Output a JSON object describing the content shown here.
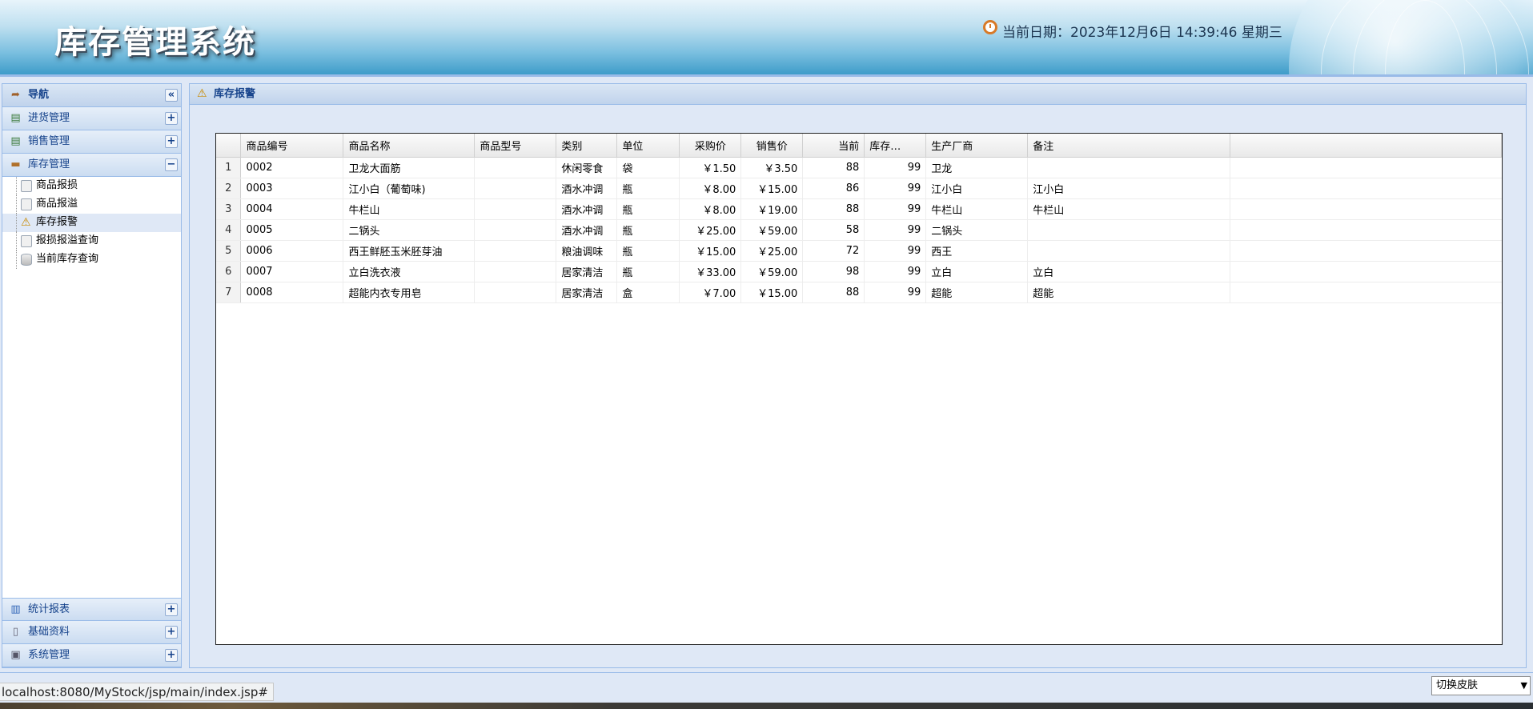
{
  "header": {
    "app_title": "库存管理系统",
    "date_text": "当前日期：2023年12月6日 14:39:46 星期三"
  },
  "sidebar": {
    "nav_title": "导航",
    "sections_top": [
      {
        "label": "进货管理",
        "tool": "+"
      },
      {
        "label": "销售管理",
        "tool": "+"
      },
      {
        "label": "库存管理",
        "tool": "−"
      }
    ],
    "inventory_items": [
      {
        "label": "商品报损"
      },
      {
        "label": "商品报溢"
      },
      {
        "label": "库存报警"
      },
      {
        "label": "报损报溢查询"
      },
      {
        "label": "当前库存查询"
      }
    ],
    "sections_bottom": [
      {
        "label": "统计报表",
        "tool": "+"
      },
      {
        "label": "基础资料",
        "tool": "+"
      },
      {
        "label": "系统管理",
        "tool": "+"
      }
    ]
  },
  "main": {
    "panel_title": "库存报警",
    "columns": [
      "商品编号",
      "商品名称",
      "商品型号",
      "类别",
      "单位",
      "采购价",
      "销售价",
      "当前",
      "库存…",
      "生产厂商",
      "备注"
    ],
    "rows": [
      {
        "n": "1",
        "code": "0002",
        "name": "卫龙大面筋",
        "model": "",
        "category": "休闲零食",
        "unit": "袋",
        "cost": "￥1.50",
        "price": "￥3.50",
        "stock": "88",
        "limit": "99",
        "maker": "卫龙",
        "remark": ""
      },
      {
        "n": "2",
        "code": "0003",
        "name": "江小白（葡萄味)",
        "model": "",
        "category": "酒水冲调",
        "unit": "瓶",
        "cost": "￥8.00",
        "price": "￥15.00",
        "stock": "86",
        "limit": "99",
        "maker": "江小白",
        "remark": "江小白"
      },
      {
        "n": "3",
        "code": "0004",
        "name": "牛栏山",
        "model": "",
        "category": "酒水冲调",
        "unit": "瓶",
        "cost": "￥8.00",
        "price": "￥19.00",
        "stock": "88",
        "limit": "99",
        "maker": "牛栏山",
        "remark": "牛栏山"
      },
      {
        "n": "4",
        "code": "0005",
        "name": "二锅头",
        "model": "",
        "category": "酒水冲调",
        "unit": "瓶",
        "cost": "￥25.00",
        "price": "￥59.00",
        "stock": "58",
        "limit": "99",
        "maker": "二锅头",
        "remark": ""
      },
      {
        "n": "5",
        "code": "0006",
        "name": "西王鲜胚玉米胚芽油",
        "model": "",
        "category": "粮油调味",
        "unit": "瓶",
        "cost": "￥15.00",
        "price": "￥25.00",
        "stock": "72",
        "limit": "99",
        "maker": "西王",
        "remark": ""
      },
      {
        "n": "6",
        "code": "0007",
        "name": "立白洗衣液",
        "model": "",
        "category": "居家清洁",
        "unit": "瓶",
        "cost": "￥33.00",
        "price": "￥59.00",
        "stock": "98",
        "limit": "99",
        "maker": "立白",
        "remark": "立白"
      },
      {
        "n": "7",
        "code": "0008",
        "name": "超能内衣专用皂",
        "model": "",
        "category": "居家清洁",
        "unit": "盒",
        "cost": "￥7.00",
        "price": "￥15.00",
        "stock": "88",
        "limit": "99",
        "maker": "超能",
        "remark": "超能"
      }
    ]
  },
  "footer": {
    "status_url": "localhost:8080/MyStock/jsp/main/index.jsp#",
    "skin_select_value": "切换皮肤"
  }
}
